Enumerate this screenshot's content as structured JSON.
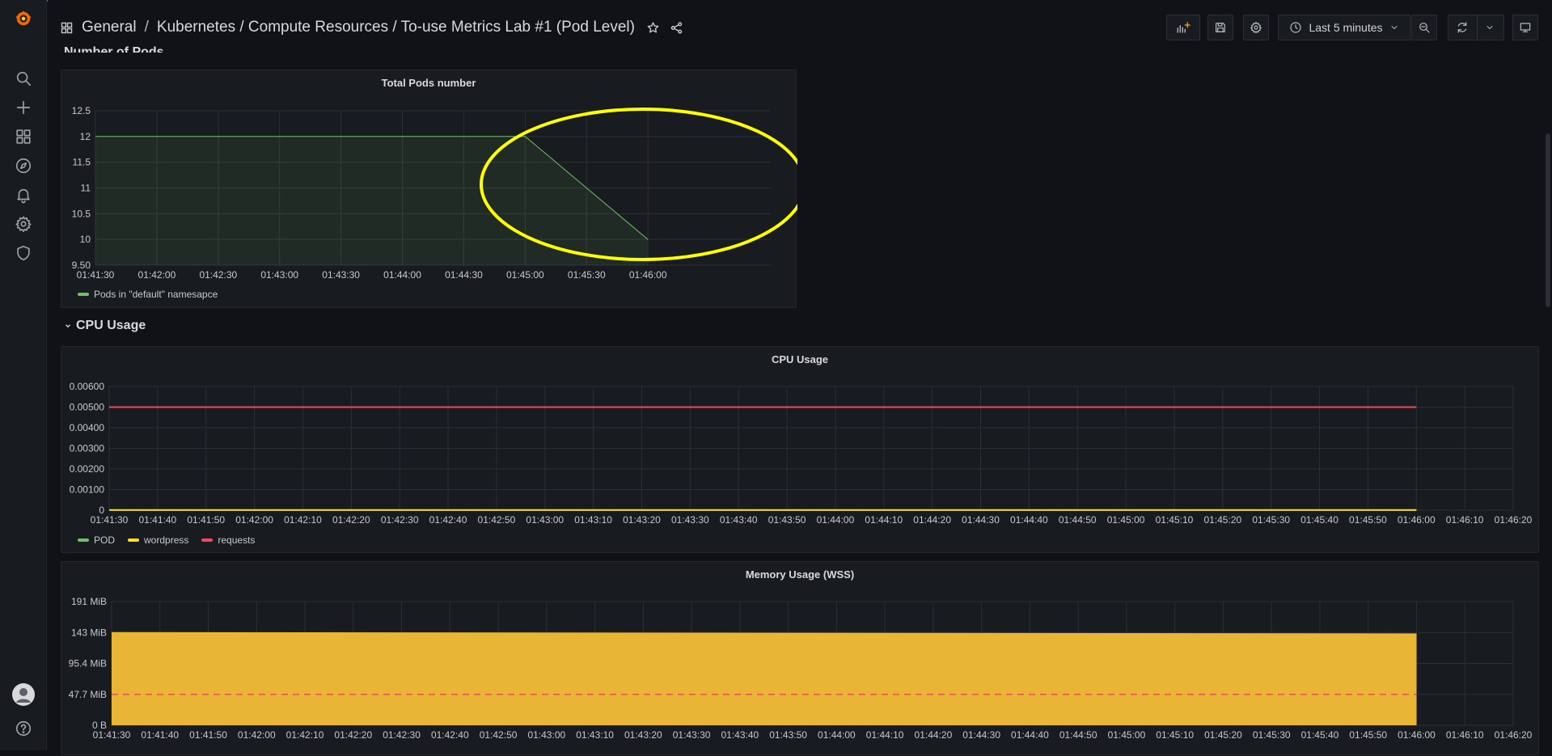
{
  "breadcrumb": {
    "folder": "General",
    "dashboard_path": "Kubernetes / Compute Resources / To-use Metrics Lab #1 (Pod Level)"
  },
  "toolbar": {
    "time_range_label": "Last 5 minutes"
  },
  "icons": {
    "logo": "grafana-logo-icon",
    "search": "search-icon",
    "create": "plus-icon",
    "dashboards": "dashboards-grid-icon",
    "explore": "compass-icon",
    "alerting": "bell-icon",
    "configuration": "gear-icon",
    "server_admin": "shield-icon",
    "profile": "avatar-icon",
    "help": "question-icon"
  },
  "rows": {
    "pods_row_title": "Number of Pods",
    "cpu_row_title": "CPU Usage"
  },
  "colors": {
    "green_series": "#73bf69",
    "yellow_series": "#fade2a",
    "red_series": "#f2495c",
    "memory_fill": "#e8b534",
    "annotation": "#ffff00",
    "accent": "#3d71d9"
  },
  "panels": {
    "pods": {
      "title": "Total Pods number",
      "legend": [
        {
          "name": "Pods in \"default\" namesapce",
          "color": "#73bf69"
        }
      ]
    },
    "cpu": {
      "title": "CPU Usage",
      "legend": [
        {
          "name": "POD",
          "color": "#73bf69"
        },
        {
          "name": "wordpress",
          "color": "#fade2a"
        },
        {
          "name": "requests",
          "color": "#f2495c"
        }
      ]
    },
    "memory": {
      "title": "Memory Usage (WSS)"
    }
  },
  "chart_data": [
    {
      "type": "area",
      "title": "Total Pods number",
      "x_ticks": [
        "01:41:30",
        "01:42:00",
        "01:42:30",
        "01:43:00",
        "01:43:30",
        "01:44:00",
        "01:44:30",
        "01:45:00",
        "01:45:30",
        "01:46:00"
      ],
      "y_ticks": [
        "12.5",
        "12",
        "11.5",
        "11",
        "10.5",
        "10",
        "9.50"
      ],
      "ylim": [
        9.5,
        12.5
      ],
      "series": [
        {
          "name": "Pods in \"default\" namesapce",
          "x": [
            "01:41:30",
            "01:45:00",
            "01:46:00"
          ],
          "values": [
            12,
            12,
            10
          ]
        }
      ],
      "grid": true,
      "legend_position": "bottom-left"
    },
    {
      "type": "line",
      "title": "CPU Usage",
      "x_ticks": [
        "01:41:30",
        "01:41:40",
        "01:41:50",
        "01:42:00",
        "01:42:10",
        "01:42:20",
        "01:42:30",
        "01:42:40",
        "01:42:50",
        "01:43:00",
        "01:43:10",
        "01:43:20",
        "01:43:30",
        "01:43:40",
        "01:43:50",
        "01:44:00",
        "01:44:10",
        "01:44:20",
        "01:44:30",
        "01:44:40",
        "01:44:50",
        "01:45:00",
        "01:45:10",
        "01:45:20",
        "01:45:30",
        "01:45:40",
        "01:45:50",
        "01:46:00",
        "01:46:10",
        "01:46:20"
      ],
      "y_ticks": [
        "0.00600",
        "0.00500",
        "0.00400",
        "0.00300",
        "0.00200",
        "0.00100",
        "0"
      ],
      "ylim": [
        0,
        0.006
      ],
      "series": [
        {
          "name": "POD",
          "x": [
            "01:41:30",
            "01:46:00"
          ],
          "values": [
            0,
            0
          ]
        },
        {
          "name": "wordpress",
          "x": [
            "01:41:30",
            "01:46:00"
          ],
          "values": [
            1e-05,
            1e-05
          ]
        },
        {
          "name": "requests",
          "x": [
            "01:41:30",
            "01:46:00"
          ],
          "values": [
            0.005,
            0.005
          ]
        }
      ],
      "grid": true,
      "legend_position": "bottom-left"
    },
    {
      "type": "area",
      "title": "Memory Usage (WSS)",
      "x_ticks": [
        "01:41:30",
        "01:41:40",
        "01:41:50",
        "01:42:00",
        "01:42:10",
        "01:42:20",
        "01:42:30",
        "01:42:40",
        "01:42:50",
        "01:43:00",
        "01:43:10",
        "01:43:20",
        "01:43:30",
        "01:43:40",
        "01:43:50",
        "01:44:00",
        "01:44:10",
        "01:44:20",
        "01:44:30",
        "01:44:40",
        "01:44:50",
        "01:45:00",
        "01:45:10",
        "01:45:20",
        "01:45:30",
        "01:45:40",
        "01:45:50",
        "01:46:00",
        "01:46:10",
        "01:46:20"
      ],
      "y_ticks": [
        "191 MiB",
        "143 MiB",
        "95.4 MiB",
        "47.7 MiB",
        "0 B"
      ],
      "ylim": [
        0,
        191
      ],
      "y_unit": "MiB",
      "series": [
        {
          "x": [
            "01:41:30",
            "01:46:00"
          ],
          "values": [
            143,
            141
          ]
        },
        {
          "x": [
            "01:41:30",
            "01:46:00"
          ],
          "values": [
            47.7,
            47.7
          ],
          "style": "dashed"
        }
      ],
      "grid": true
    }
  ]
}
